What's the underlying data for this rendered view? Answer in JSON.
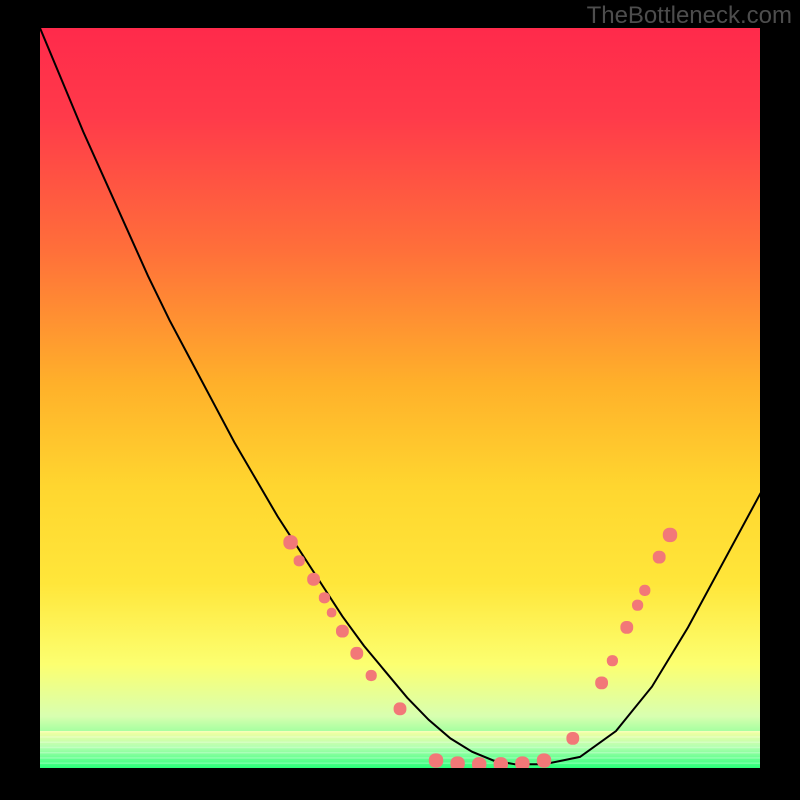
{
  "watermark": "TheBottleneck.com",
  "chart_data": {
    "type": "line",
    "title": "",
    "xlabel": "",
    "ylabel": "",
    "xlim": [
      0,
      100
    ],
    "ylim": [
      0,
      100
    ],
    "background_gradient": {
      "top": "#ff2a4b",
      "upper_mid": "#ffb02a",
      "mid": "#ffe63a",
      "lower_mid": "#f6ffa0",
      "bottom": "#2aff7a"
    },
    "series": [
      {
        "name": "bottleneck-curve",
        "color": "#000000",
        "stroke_width": 2,
        "x": [
          0,
          3,
          6,
          9,
          12,
          15,
          18,
          21,
          24,
          27,
          30,
          33,
          36,
          39,
          42,
          45,
          48,
          51,
          54,
          57,
          60,
          63,
          66,
          70,
          75,
          80,
          85,
          90,
          95,
          100,
          105
        ],
        "y": [
          100,
          93,
          86,
          79.5,
          73,
          66.5,
          60.5,
          55,
          49.5,
          44,
          39,
          34,
          29.5,
          25,
          20.5,
          16.5,
          13,
          9.5,
          6.5,
          4,
          2.2,
          1.0,
          0.5,
          0.5,
          1.5,
          5,
          11,
          19,
          28,
          37,
          45
        ]
      }
    ],
    "markers": {
      "name": "data-points",
      "color": "#f27878",
      "shape": "rounded-square",
      "size_range": [
        6,
        10
      ],
      "points": [
        {
          "x": 34.8,
          "y": 30.5,
          "s": 9
        },
        {
          "x": 36.0,
          "y": 28.0,
          "s": 7
        },
        {
          "x": 38.0,
          "y": 25.5,
          "s": 8
        },
        {
          "x": 39.5,
          "y": 23.0,
          "s": 7
        },
        {
          "x": 40.5,
          "y": 21.0,
          "s": 6
        },
        {
          "x": 42.0,
          "y": 18.5,
          "s": 8
        },
        {
          "x": 44.0,
          "y": 15.5,
          "s": 8
        },
        {
          "x": 46.0,
          "y": 12.5,
          "s": 7
        },
        {
          "x": 50.0,
          "y": 8.0,
          "s": 8
        },
        {
          "x": 55.0,
          "y": 1.0,
          "s": 9
        },
        {
          "x": 58.0,
          "y": 0.6,
          "s": 9
        },
        {
          "x": 61.0,
          "y": 0.5,
          "s": 9
        },
        {
          "x": 64.0,
          "y": 0.5,
          "s": 9
        },
        {
          "x": 67.0,
          "y": 0.6,
          "s": 9
        },
        {
          "x": 70.0,
          "y": 1.0,
          "s": 9
        },
        {
          "x": 74.0,
          "y": 4.0,
          "s": 8
        },
        {
          "x": 78.0,
          "y": 11.5,
          "s": 8
        },
        {
          "x": 79.5,
          "y": 14.5,
          "s": 7
        },
        {
          "x": 81.5,
          "y": 19.0,
          "s": 8
        },
        {
          "x": 83.0,
          "y": 22.0,
          "s": 7
        },
        {
          "x": 84.0,
          "y": 24.0,
          "s": 7
        },
        {
          "x": 86.0,
          "y": 28.5,
          "s": 8
        },
        {
          "x": 87.5,
          "y": 31.5,
          "s": 9
        }
      ]
    },
    "green_band": {
      "y_bottom": 0,
      "y_top": 5
    }
  }
}
